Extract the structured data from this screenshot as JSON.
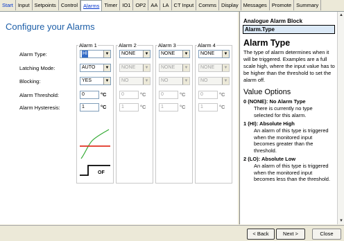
{
  "tabs": [
    {
      "label": "Start",
      "active": false,
      "link": true
    },
    {
      "label": "Input",
      "active": false
    },
    {
      "label": "Setpoints",
      "active": false
    },
    {
      "label": "Control",
      "active": false
    },
    {
      "label": "Alarms",
      "active": true
    },
    {
      "label": "Timer",
      "active": false
    },
    {
      "label": "IO1",
      "active": false
    },
    {
      "label": "OP2",
      "active": false
    },
    {
      "label": "AA",
      "active": false
    },
    {
      "label": "LA",
      "active": false
    },
    {
      "label": "CT Input",
      "active": false
    },
    {
      "label": "Comms",
      "active": false
    },
    {
      "label": "Display",
      "active": false
    },
    {
      "label": "Messages",
      "active": false
    },
    {
      "label": "Promote",
      "active": false
    },
    {
      "label": "Summary",
      "active": false
    }
  ],
  "page": {
    "title": "Configure your Alarms"
  },
  "fields": {
    "alarm_type": "Alarm Type:",
    "latching_mode": "Latching Mode:",
    "blocking": "Blocking:",
    "alarm_threshold": "Alarm Threshold:",
    "alarm_hysteresis": "Alarm Hysteresis:"
  },
  "alarms": [
    {
      "name": "Alarm 1",
      "type": "HI",
      "latching": "AUTO",
      "blocking": "YES",
      "threshold": "0",
      "hysteresis": "1",
      "unit": "°C",
      "enabled": true
    },
    {
      "name": "Alarm 2",
      "type": "NONE",
      "latching": "NONE",
      "blocking": "NO",
      "threshold": "0",
      "hysteresis": "1",
      "unit": "°C",
      "enabled": false
    },
    {
      "name": "Alarm 3",
      "type": "NONE",
      "latching": "NONE",
      "blocking": "NO",
      "threshold": "0",
      "hysteresis": "1",
      "unit": "°C",
      "enabled": false
    },
    {
      "name": "Alarm 4",
      "type": "NONE",
      "latching": "NONE",
      "blocking": "NO",
      "threshold": "0",
      "hysteresis": "1",
      "unit": "°C",
      "enabled": false
    }
  ],
  "diagram": {
    "output_label": "OF",
    "colors": {
      "threshold": "#e03020",
      "signal": "#33aa33",
      "output": "#000000"
    }
  },
  "help": {
    "block_title": "Analogue Alarm Block",
    "param": "Alarm.Type",
    "heading": "Alarm Type",
    "intro": "The type of alarm determines when it will be triggered. Examples are a full scale high, where the input value has to be higher than the threshold to set the alarm off.",
    "values_heading": "Value Options",
    "options": [
      {
        "title": "0 (NONE): No Alarm Type",
        "desc": "There is currently no type selected for this alarm."
      },
      {
        "title": "1 (HI): Absolute High",
        "desc": "An alarm of this type is triggered when the monitored input becomes greater than the threshold."
      },
      {
        "title": "2 (LO): Absolute Low",
        "desc": "An alarm of this type is triggered when the monitored input becomes less than the threshold."
      }
    ]
  },
  "buttons": {
    "back": "< Back",
    "next": "Next >",
    "close": "Close"
  }
}
